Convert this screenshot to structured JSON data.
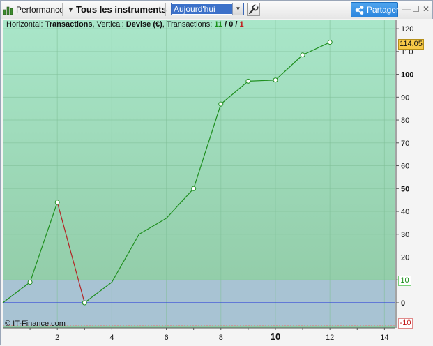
{
  "toolbar": {
    "performance_label": "Performance",
    "instruments_label": "Tous les instruments",
    "period_value": "Aujourd'hui",
    "share_label": "Partager",
    "minimize_glyph": "—",
    "restore_glyph": "☐",
    "close_glyph": "✕"
  },
  "caption": {
    "horizontal_prefix": "Horizontal: ",
    "horizontal_value": "Transactions",
    "vertical_prefix": ", Vertical: ",
    "vertical_value": "Devise (€)",
    "transactions_prefix": ", Transactions: ",
    "count_total": "11",
    "slash1": " / ",
    "count_neutral": "0",
    "slash2": " / ",
    "count_loss": "1"
  },
  "watermark": "© IT-Finance.com",
  "tags": {
    "last_value": "114,05",
    "upper_zone": "10",
    "lower_zone": "-10"
  },
  "colors": {
    "gain_line": "#1f8f1f",
    "loss_line": "#b32525",
    "zero_line": "#1c2fd8",
    "zone_band": "#a8c3d3",
    "plot_top": "#a9e6c9",
    "plot_bottom": "#8fc9a4",
    "marker_fill": "#ffffff",
    "price_tag": "#f7c948"
  },
  "chart_data": {
    "type": "line",
    "xlabel": "Transactions",
    "ylabel": "Devise (€)",
    "x": [
      0,
      1,
      2,
      3,
      4,
      5,
      6,
      7,
      8,
      9,
      10,
      11,
      12
    ],
    "y": [
      0,
      9,
      44,
      0,
      9,
      30,
      37,
      50,
      87,
      97,
      97.5,
      108.5,
      114.05
    ],
    "segment_colors": [
      "gain",
      "gain",
      "loss",
      "gain",
      "gain",
      "gain",
      "gain",
      "gain",
      "gain",
      "gain",
      "gain",
      "gain"
    ],
    "markers": [
      1,
      2,
      3,
      7,
      8,
      9,
      10,
      11,
      12
    ],
    "xlim": [
      0,
      14.4
    ],
    "ylim": [
      -11,
      124
    ],
    "x_ticks": [
      2,
      4,
      6,
      8,
      10,
      12,
      14
    ],
    "x_major_tick": 10,
    "y_ticks": [
      120,
      110,
      100,
      90,
      80,
      70,
      60,
      50,
      40,
      30,
      20,
      10,
      0
    ],
    "y_major_ticks": [
      100,
      50,
      0
    ],
    "y_tick_labels": [
      "120",
      "110",
      "100",
      "90",
      "80",
      "70",
      "60",
      "50",
      "40",
      "30",
      "20",
      "",
      "0"
    ],
    "zero_line": 0,
    "neutral_band": [
      -10,
      10
    ],
    "last_value": 114.05,
    "grid": true
  }
}
